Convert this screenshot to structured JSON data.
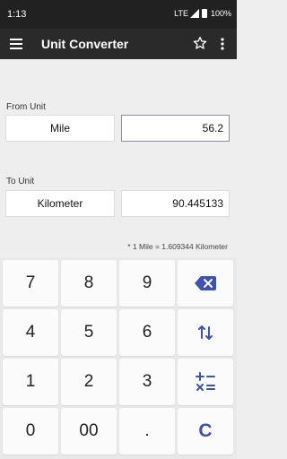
{
  "status_bar": {
    "time": "1:13",
    "network": "LTE",
    "battery": "100%"
  },
  "app_bar": {
    "title": "Unit Converter",
    "menu_icon": "hamburger-menu-icon",
    "star_icon": "star-outline-icon",
    "more_icon": "more-vert-icon"
  },
  "from": {
    "label": "From Unit",
    "unit": "Mile",
    "value": "56.2"
  },
  "to": {
    "label": "To Unit",
    "unit": "Kilometer",
    "value": "90.445133"
  },
  "conversion_note": "* 1 Mile = 1.609344 Kilometer",
  "keypad": {
    "keys": [
      "7",
      "8",
      "9",
      "4",
      "5",
      "6",
      "1",
      "2",
      "3",
      "0",
      "00",
      "."
    ],
    "backspace_icon": "backspace-icon",
    "swap_icon": "swap-vertical-icon",
    "operators_icon": "math-operators-icon",
    "clear_label": "C"
  },
  "colors": {
    "accent": "#3f51b5",
    "status_bar": "#212121",
    "app_bar": "#2a2a2a",
    "background": "#eeeeee",
    "key_background": "#fbfbfb"
  }
}
